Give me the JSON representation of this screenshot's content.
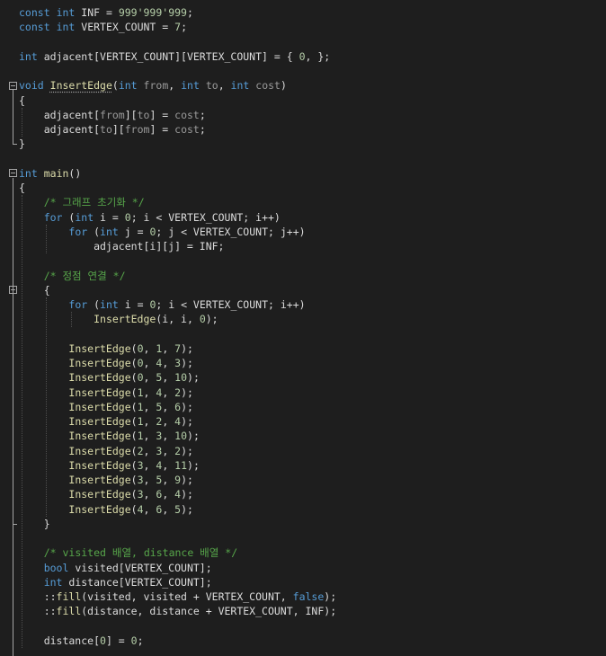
{
  "editor": {
    "lines": [
      "const int INF = 999'999'999;",
      "const int VERTEX_COUNT = 7;",
      "",
      "int adjacent[VERTEX_COUNT][VERTEX_COUNT] = { 0, };",
      "",
      "void InsertEdge(int from, int to, int cost)",
      "{",
      "    adjacent[from][to] = cost;",
      "    adjacent[to][from] = cost;",
      "}",
      "",
      "int main()",
      "{",
      "    /* 그래프 초기화 */",
      "    for (int i = 0; i < VERTEX_COUNT; i++)",
      "        for (int j = 0; j < VERTEX_COUNT; j++)",
      "            adjacent[i][j] = INF;",
      "",
      "    /* 정점 연결 */",
      "    {",
      "        for (int i = 0; i < VERTEX_COUNT; i++)",
      "            InsertEdge(i, i, 0);",
      "",
      "        InsertEdge(0, 1, 7);",
      "        InsertEdge(0, 4, 3);",
      "        InsertEdge(0, 5, 10);",
      "        InsertEdge(1, 4, 2);",
      "        InsertEdge(1, 5, 6);",
      "        InsertEdge(1, 2, 4);",
      "        InsertEdge(1, 3, 10);",
      "        InsertEdge(2, 3, 2);",
      "        InsertEdge(3, 4, 11);",
      "        InsertEdge(3, 5, 9);",
      "        InsertEdge(3, 6, 4);",
      "        InsertEdge(4, 6, 5);",
      "    }",
      "",
      "    /* visited 배열, distance 배열 */",
      "    bool visited[VERTEX_COUNT];",
      "    int distance[VERTEX_COUNT];",
      "    ::fill(visited, visited + VERTEX_COUNT, false);",
      "    ::fill(distance, distance + VERTEX_COUNT, INF);",
      "",
      "    distance[0] = 0;"
    ],
    "colors": {
      "background": "#1e1e1e",
      "keyword": "#569cd6",
      "comment": "#57a64a",
      "number": "#b5cea8",
      "function": "#dcdcaa",
      "parameter": "#9a9a9a",
      "text": "#dcdcdc"
    },
    "fold_markers": [
      "collapse-icon",
      "collapse-icon",
      "collapse-icon"
    ]
  }
}
